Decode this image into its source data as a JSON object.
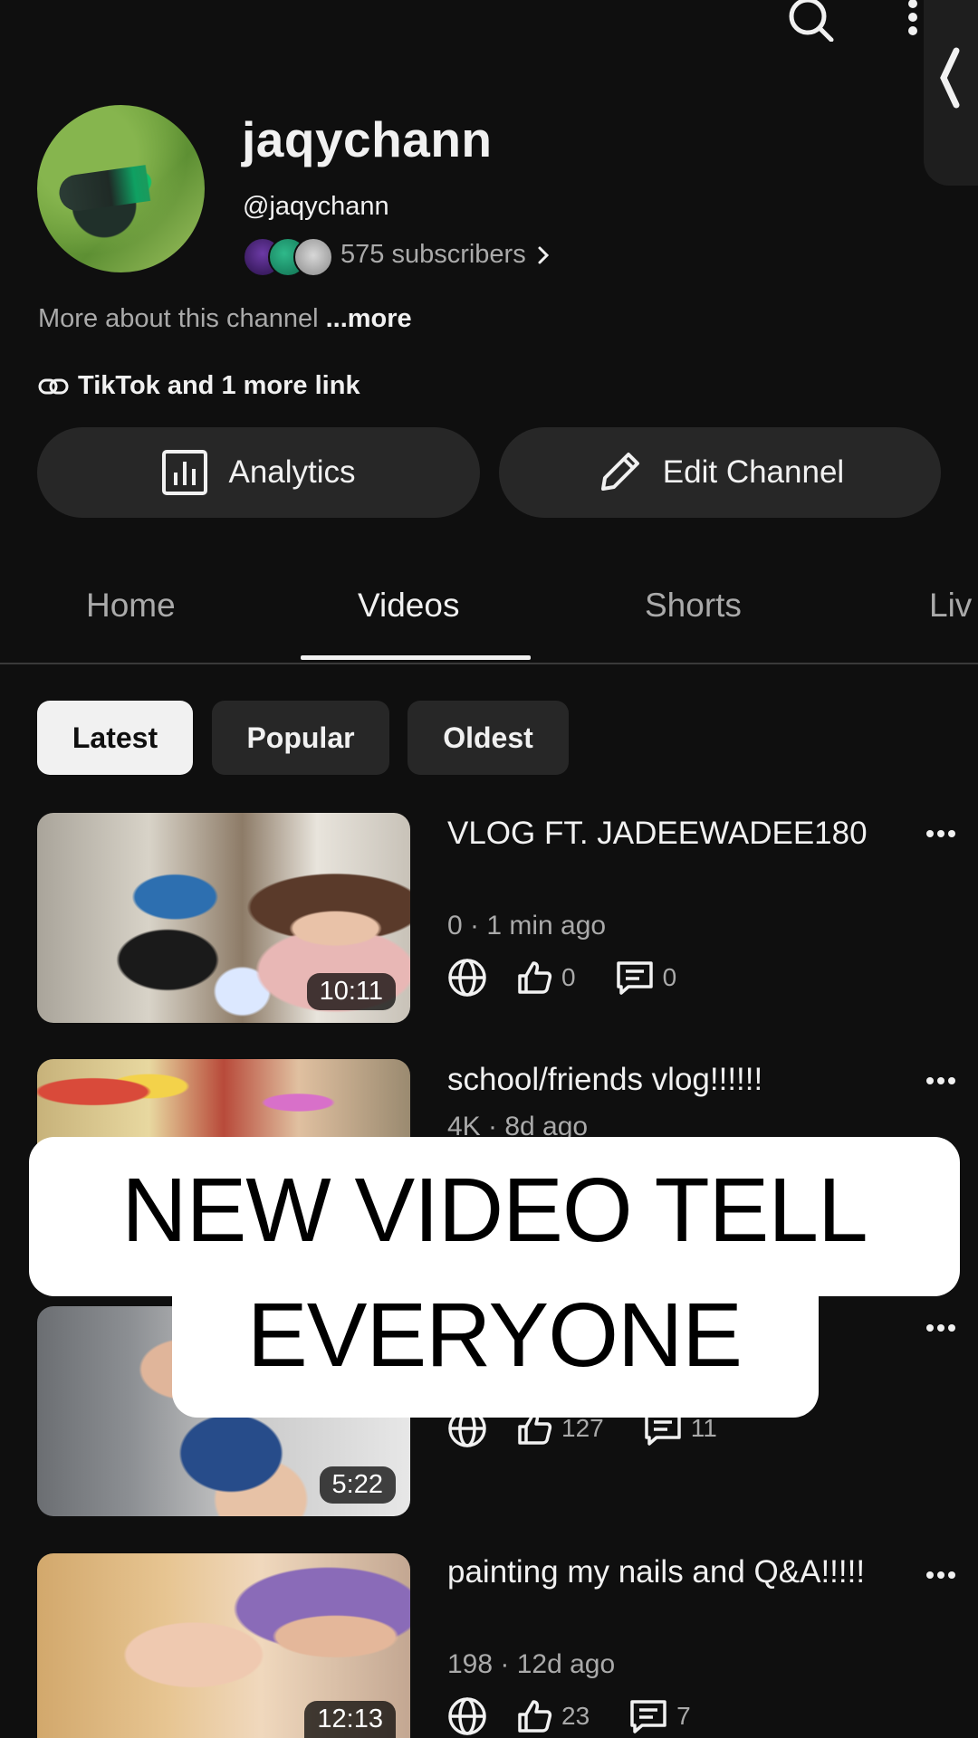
{
  "header": {
    "channel_name": "jaqychann",
    "handle": "@jaqychann",
    "subscribers": "575 subscribers",
    "about_text": "More about this channel",
    "about_more": "...more",
    "links": "TikTok and 1 more link"
  },
  "buttons": {
    "analytics": "Analytics",
    "edit_channel": "Edit Channel"
  },
  "tabs": [
    {
      "label": "Home",
      "active": false
    },
    {
      "label": "Videos",
      "active": true
    },
    {
      "label": "Shorts",
      "active": false
    },
    {
      "label": "Liv",
      "active": false
    }
  ],
  "chips": [
    {
      "label": "Latest",
      "selected": true
    },
    {
      "label": "Popular",
      "selected": false
    },
    {
      "label": "Oldest",
      "selected": false
    }
  ],
  "videos": [
    {
      "title": "VLOG FT. JADEEWADEE180",
      "meta": "0 · 1 min ago",
      "likes": "0",
      "comments": "0",
      "duration": "10:11"
    },
    {
      "title": "school/friends vlog!!!!!!",
      "meta": "4K · 8d ago",
      "likes": "",
      "comments": "",
      "duration": ""
    },
    {
      "title": "!",
      "meta": "",
      "likes": "127",
      "comments": "11",
      "duration": "5:22"
    },
    {
      "title": "painting my nails and Q&A!!!!!",
      "meta": "198 · 12d ago",
      "likes": "23",
      "comments": "7",
      "duration": "12:13"
    }
  ],
  "overlay": {
    "line1": "NEW VIDEO TELL",
    "line2": "EVERYONE"
  },
  "colors": {
    "background": "#0f0f0f",
    "surface": "#272727",
    "text_primary": "#f1f1f1",
    "text_secondary": "#aaaaaa"
  },
  "icons": [
    "search-icon",
    "more-vert-icon",
    "collapse-handle-icon",
    "link-icon",
    "analytics-icon",
    "pencil-icon",
    "globe-icon",
    "thumbs-up-icon",
    "comment-icon",
    "more-horiz-icon",
    "chevron-right-icon"
  ]
}
